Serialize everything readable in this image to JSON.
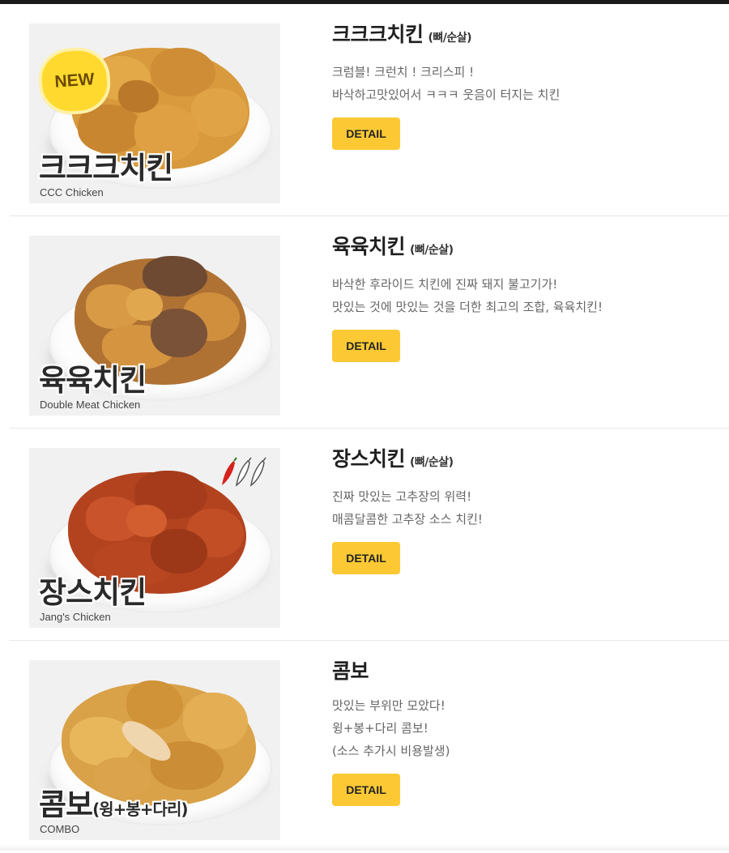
{
  "menu": {
    "items": [
      {
        "photo_name_ko": "크크크치킨",
        "photo_name_en": "CCC Chicken",
        "badge": "NEW",
        "title": "크크크치킨",
        "type_note": "(뼈/순살)",
        "desc": [
          "크럼블! 크런치 ! 크리스피 !",
          "바삭하고맛있어서 ㅋㅋㅋ 웃음이 터지는 치킨"
        ],
        "button": "DETAIL"
      },
      {
        "photo_name_ko": "육육치킨",
        "photo_name_en": "Double Meat Chicken",
        "title": "육육치킨",
        "type_note": "(뼈/순살)",
        "desc": [
          "바삭한 후라이드 치킨에 진짜 돼지 불고기가!",
          "맛있는 것에 맛있는 것을 더한 최고의 조합, 육육치킨!"
        ],
        "button": "DETAIL"
      },
      {
        "photo_name_ko": "장스치킨",
        "photo_name_en": "Jang's Chicken",
        "spice_icon": "three-chili-peppers-icon",
        "title": "장스치킨",
        "type_note": "(뼈/순살)",
        "desc": [
          "진짜 맛있는 고추장의 위력!",
          "매콤달콤한 고추장 소스 치킨!"
        ],
        "button": "DETAIL"
      },
      {
        "photo_name_ko": "콤보",
        "photo_name_ko_sub": "(윙+봉+다리)",
        "photo_name_en": "COMBO",
        "title": "콤보",
        "desc": [
          "맛있는 부위만 모았다!",
          "윙+봉+다리 콤보!",
          "(소스 추가시 비용발생)"
        ],
        "button": "DETAIL"
      }
    ]
  },
  "colors": {
    "button_bg": "#fcc934",
    "top_bar": "#1a1a1a",
    "badge": "#ffd92e"
  }
}
